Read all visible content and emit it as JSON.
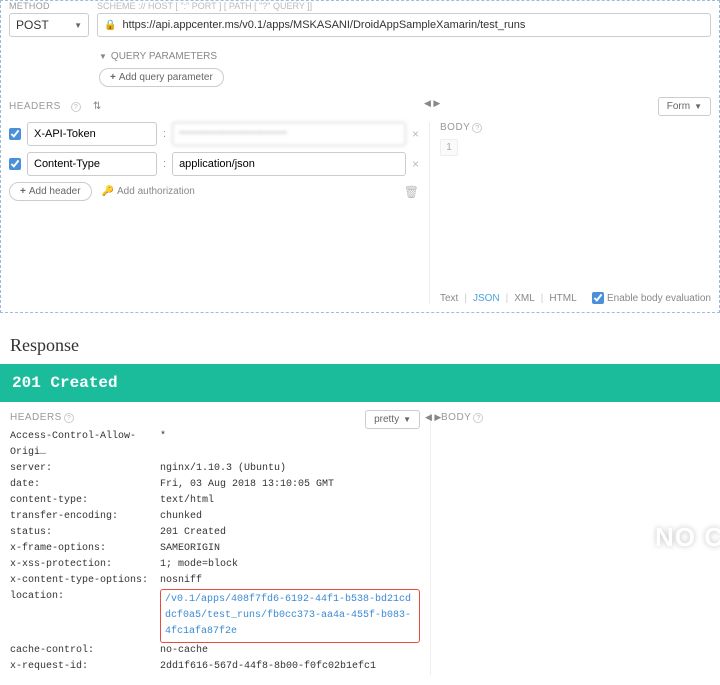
{
  "request": {
    "method_label": "METHOD",
    "method_value": "POST",
    "scheme_label": "SCHEME :// HOST [ \":\" PORT ] [ PATH [ \"?\" QUERY ]]",
    "url": "https://api.appcenter.ms/v0.1/apps/MSKASANI/DroidAppSampleXamarin/test_runs",
    "qp_title": "QUERY PARAMETERS",
    "add_qp": "Add query parameter",
    "headers_title": "HEADERS",
    "form_label": "Form",
    "headers": [
      {
        "name": "X-API-Token",
        "value": "••••••••••••••••••••••••••••"
      },
      {
        "name": "Content-Type",
        "value": "application/json"
      }
    ],
    "add_header": "Add header",
    "add_auth": "Add authorization",
    "body_title": "BODY",
    "body_tabs": {
      "text": "Text",
      "json": "JSON",
      "xml": "XML",
      "html": "HTML"
    },
    "enable_body_eval": "Enable body evaluation"
  },
  "response": {
    "title": "Response",
    "status": "201 Created",
    "headers_title": "HEADERS",
    "pretty": "pretty",
    "body_title": "BODY",
    "headers": [
      {
        "k": "Access-Control-Allow-Origi…",
        "v": "*"
      },
      {
        "k": "server:",
        "v": "nginx/1.10.3 (Ubuntu)"
      },
      {
        "k": "date:",
        "v": "Fri, 03 Aug 2018 13:10:05 GMT"
      },
      {
        "k": "content-type:",
        "v": "text/html"
      },
      {
        "k": "transfer-encoding:",
        "v": "chunked"
      },
      {
        "k": "status:",
        "v": "201 Created"
      },
      {
        "k": "x-frame-options:",
        "v": "SAMEORIGIN"
      },
      {
        "k": "x-xss-protection:",
        "v": "1; mode=block"
      },
      {
        "k": "x-content-type-options:",
        "v": "nosniff"
      },
      {
        "k": "location:",
        "v": "/v0.1/apps/408f7fd6-6192-44f1-b538-bd21cddcf0a5/test_runs/fb0cc373-aa4a-455f-b083-4fc1afa87f2e"
      },
      {
        "k": "cache-control:",
        "v": "no-cache"
      },
      {
        "k": "x-request-id:",
        "v": "2dd1f616-567d-44f8-8b00-f0fc02b1efc1"
      }
    ]
  },
  "watermark": "NO C"
}
